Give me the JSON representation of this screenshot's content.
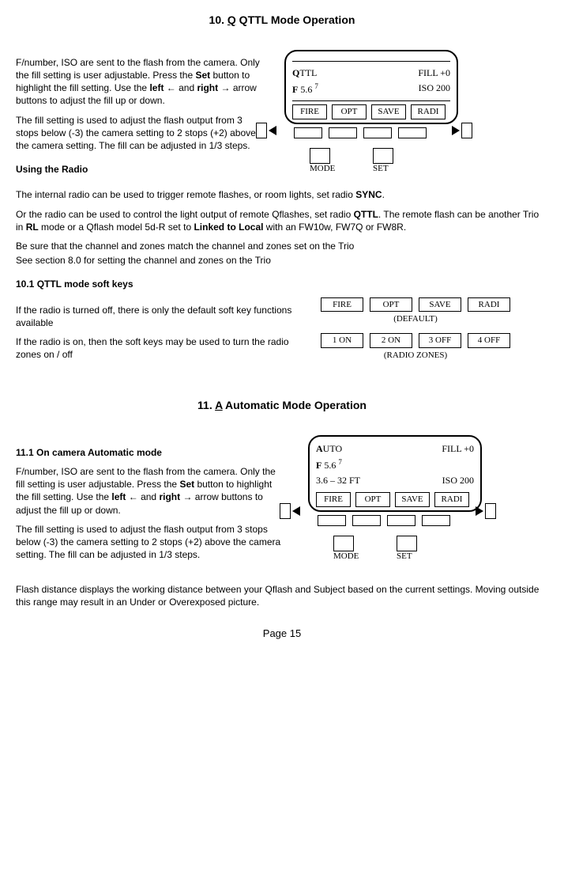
{
  "section10": {
    "heading_num": "10.",
    "heading_letter": "Q",
    "heading_rest": "  QTTL Mode Operation",
    "para1": "F/number, ISO are sent to the flash from the camera.  Only the fill setting is user adjustable.  Press the ",
    "set": "Set",
    "para1b": " button to highlight the fill setting.  Use the ",
    "left": "left",
    "larrow": " ← ",
    "and": " and ",
    "right": "right",
    "rarrow": " → ",
    "para1c": " arrow buttons to adjust the fill up or down.",
    "para2": "The fill setting is used to adjust the flash output from 3 stops below (-3) the camera setting to 2 stops (+2) above the camera setting.  The fill can be adjusted in 1/3 steps.",
    "using_radio": "Using the Radio",
    "para3a": "The internal radio can be used to trigger remote flashes, or room lights, set radio ",
    "sync": "SYNC",
    "period": ".",
    "para4a": "Or the radio can be used to control the light output of remote Qflashes, set radio ",
    "qttl": "QTTL",
    "para4b": ". The remote flash can be another Trio in ",
    "rl": "RL",
    "para4c": " mode or a Qflash model 5d-R set to ",
    "ltl": "Linked to Local",
    "para4d": " with an FW10w, FW7Q or FW8R.",
    "para5": "Be sure that the channel and zones match the channel and zones set on the Trio",
    "para6": "See section 8.0 for setting the channel and zones on the Trio",
    "sub101": "10.1  QTTL mode soft keys",
    "para7": "If the radio is turned off, there is only the default soft key functions available",
    "para8": "If the radio is on, then the soft keys may be used to turn the radio zones on / off"
  },
  "softkeys_default": {
    "k1": "FIRE",
    "k2": "OPT",
    "k3": "SAVE",
    "k4": "RADI",
    "label": "(DEFAULT)"
  },
  "softkeys_zones": {
    "k1": "1 ON",
    "k2": "2 ON",
    "k3": "3 OFF",
    "k4": "4 OFF",
    "label": "(RADIO ZONES)"
  },
  "lcd1": {
    "mode_letter": "Q",
    "mode_rest": "TTL",
    "fill": "FILL  +0",
    "f_letter": "F",
    "f_rest": " 5.6 ",
    "f_sup": "7",
    "iso": "ISO 200",
    "sk1": "FIRE",
    "sk2": "OPT",
    "sk3": "SAVE",
    "sk4": "RADI",
    "mode_lbl": "MODE",
    "set_lbl": "SET"
  },
  "section11": {
    "heading_num": "11.",
    "heading_letter": "A",
    "heading_rest": "  Automatic Mode Operation",
    "sub111": "11.1  On camera Automatic mode",
    "para1": "F/number, ISO are sent to the flash from the camera.  Only the fill setting is user adjustable. Press the ",
    "set": "Set",
    "para1b": " button to highlight the fill setting.  Use the ",
    "left": "left",
    "larrow": " ← ",
    "and": " and ",
    "right": "right",
    "rarrow": " → ",
    "para1c": " arrow buttons to adjust the fill up or down.",
    "para2": "The fill setting is used to adjust the flash output from 3 stops below (-3) the camera setting to 2 stops (+2) above the camera setting.  The fill can be adjusted in 1/3 steps.",
    "para3": "Flash distance displays the working distance between your Qflash and Subject based on the current settings. Moving outside this range may result in an Under or Overexposed picture."
  },
  "lcd2": {
    "mode_letter": "A",
    "mode_rest": "UTO",
    "fill": "FILL  +0",
    "f_letter": "F",
    "f_rest": " 5.6 ",
    "f_sup": "7",
    "dist": "3.6 – 32 FT",
    "iso": "ISO 200",
    "sk1": "FIRE",
    "sk2": "OPT",
    "sk3": "SAVE",
    "sk4": "RADI",
    "mode_lbl": "MODE",
    "set_lbl": "SET"
  },
  "page": "Page 15"
}
